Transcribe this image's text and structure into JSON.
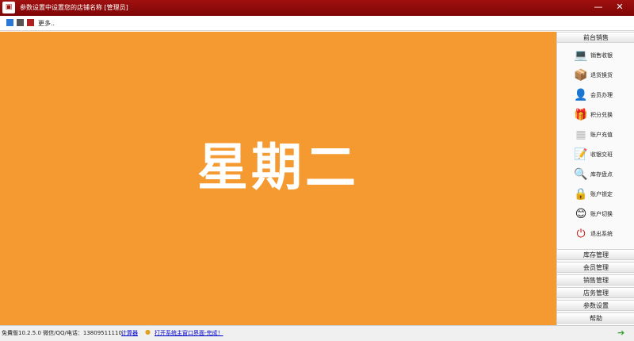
{
  "window": {
    "title": "参数设置中设置您的店铺名称  [管理员]",
    "minimize_glyph": "—",
    "close_glyph": "✕"
  },
  "toolbar": {
    "swatches": [
      "#2a7ad5",
      "#555555",
      "#b02020"
    ],
    "more_label": "更多.."
  },
  "main": {
    "background": "#f59a31",
    "weekday": "星期二"
  },
  "sidebar": {
    "front_header": "前台销售",
    "items": [
      {
        "label": "销售收银",
        "icon": "laptop-icon",
        "glyph": "💻"
      },
      {
        "label": "退货换货",
        "icon": "return-box-icon",
        "glyph": "📦"
      },
      {
        "label": "会员办理",
        "icon": "member-add-icon",
        "glyph": "👤"
      },
      {
        "label": "积分兑换",
        "icon": "gift-icon",
        "glyph": "🎁"
      },
      {
        "label": "账户充值",
        "icon": "calendar-grid-icon",
        "glyph": "▦"
      },
      {
        "label": "收银交班",
        "icon": "document-check-icon",
        "glyph": "📝"
      },
      {
        "label": "库存盘点",
        "icon": "magnifier-icon",
        "glyph": "🔍"
      },
      {
        "label": "账户锁定",
        "icon": "lock-icon",
        "glyph": "🔒"
      },
      {
        "label": "账户切换",
        "icon": "switch-user-icon",
        "glyph": "😊"
      },
      {
        "label": "退出系统",
        "icon": "power-icon",
        "glyph": "⏻"
      }
    ],
    "sections": [
      "库存管理",
      "会员管理",
      "销售管理",
      "店务管理",
      "参数设置",
      "帮助"
    ]
  },
  "statusbar": {
    "version_text": "免費版10.2.5.0 微信/QQ/电话：13809511110",
    "calculator_link": "计算器",
    "open_link": "打开系统主窗口界面-完成！",
    "arrow_glyph": "➔"
  }
}
